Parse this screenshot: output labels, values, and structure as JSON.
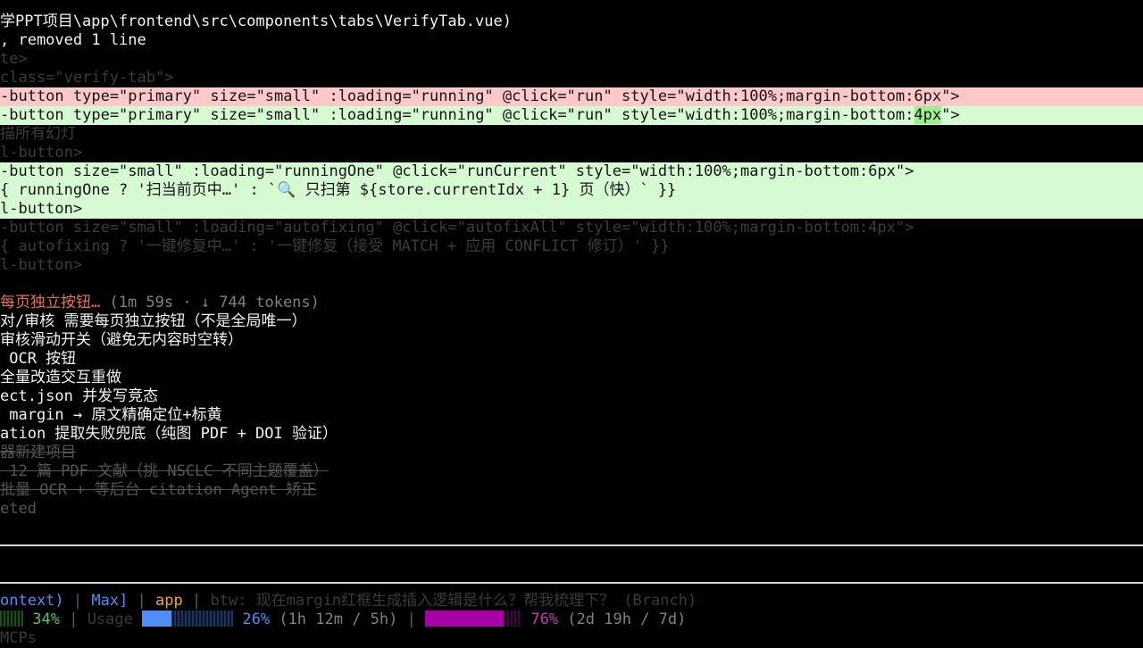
{
  "diff": {
    "path_line": "学PPT项目\\app\\frontend\\src\\components\\tabs\\VerifyTab.vue)",
    "summary": ", removed 1 line",
    "ctx1": "te>",
    "ctx2": "class=\"verify-tab\">",
    "removed_line": "-button type=\"primary\" size=\"small\" :loading=\"running\" @click=\"run\" style=\"width:100%;margin-bottom:6px\">",
    "added_line_pre": "-button type=\"primary\" size=\"small\" :loading=\"running\" @click=\"run\" style=\"width:100%;margin-bottom:",
    "added_line_hl": "4px",
    "added_line_post": "\">",
    "ctx3": "描所有幻灯",
    "ctx4": "l-button>",
    "added2_1": "-button size=\"small\" :loading=\"runningOne\" @click=\"runCurrent\" style=\"width:100%;margin-bottom:6px\">",
    "added2_2": "{ runningOne ? '扫当前页中…' : `🔍 只扫第 ${store.currentIdx + 1} 页（快）` }}",
    "added2_3": "l-button>",
    "ctx5": "-button size=\"small\" :loading=\"autofixing\" @click=\"autofixAll\" style=\"width:100%;margin-bottom:4px\">",
    "ctx6": "{ autofixing ? '一键修复中…' : '一键修复（接受 MATCH + 应用 CONFLICT 修订）' }}",
    "ctx7": "l-button>"
  },
  "status": {
    "spinner_text": "每页独立按钮…",
    "spinner_meta": " (1m 59s · ↓ 744 tokens)"
  },
  "todos": [
    "对/审核 需要每页独立按钮（不是全局唯一）",
    "审核滑动开关（避免无内容时空转）",
    " OCR 按钮",
    "全量改造交互重做",
    "ect.json 并发写竞态",
    " margin → 原文精确定位+标黄",
    "ation 提取失败兜底（纯图 PDF + DOI 验证）"
  ],
  "todos_done": [
    "器新建项目",
    " 12 篇 PDF 文献（挑 NSCLC 不同主题覆盖）",
    "批量 OCR + 等后台 citation Agent 矫正"
  ],
  "completed_tail": "eted",
  "footer": {
    "context_label": "ontext)",
    "sep1": " | ",
    "max_label": "Max]",
    "sep2": " | ",
    "app_label": "app",
    "sep3": " | ",
    "btw_text": "btw: 现在margin红框生成插入逻辑是什么？帮我梳理下？ (Branch)",
    "context_pct": "34%",
    "sep4": " | ",
    "usage_label": "Usage ",
    "usage_pct": "26%",
    "usage_detail": " (1h 12m / 5h)",
    "sep5": " | ",
    "weekly_pct": "76%",
    "weekly_detail": " (2d 19h / 7d)",
    "mcps_label": "MCPs"
  },
  "meters": {
    "context_fraction": 0.34,
    "usage_fraction": 0.26,
    "weekly_fraction": 0.76
  },
  "colors": {
    "removed_bg": "#ffc9c9",
    "added_bg": "#d6fbd2",
    "accent_blue": "#4f8ef7",
    "accent_magenta": "#a800a8",
    "accent_gold": "#e3a93b",
    "accent_green": "#5bc35b",
    "spinner_orange": "#e8735a"
  }
}
